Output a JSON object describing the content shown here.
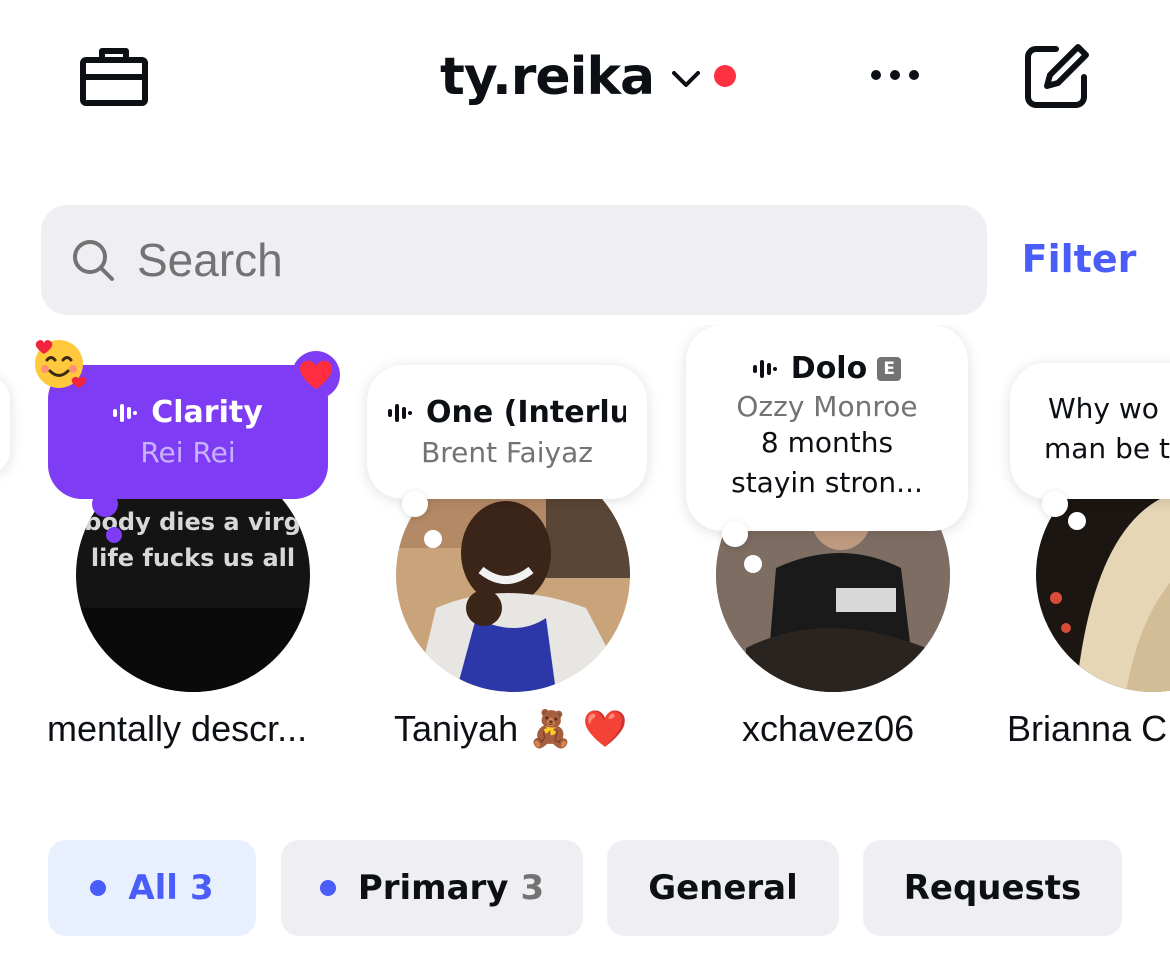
{
  "header": {
    "account_name": "ty.reika",
    "icons": {
      "professional": "briefcase-icon",
      "switch_account": "chevron-down-icon",
      "more": "more-horizontal-icon",
      "new_message": "compose-icon"
    },
    "notification_dot_color": "#ff3040"
  },
  "search": {
    "placeholder": "Search",
    "value": "",
    "filter_label": "Filter"
  },
  "notes": [
    {
      "type": "music",
      "song": "Clarity",
      "artist": "Rei Rei",
      "name": "mentally descr...",
      "own_note": true,
      "bubble_color": "#7e3df5",
      "reactions": [
        "smiling-face-with-hearts-emoji",
        "red-heart-emoji"
      ],
      "avatar_text": [
        "nobody dies a virgin,",
        "life fucks us all"
      ]
    },
    {
      "type": "music",
      "song": "One (Interlu",
      "artist": "Brent Faiyaz",
      "name": "Taniyah 🧸 ❤️"
    },
    {
      "type": "music",
      "song": "Dolo",
      "explicit_badge": "E",
      "artist": "Ozzy Monroe",
      "text_lines": [
        "8 months",
        "stayin stron..."
      ],
      "name": "xchavez06"
    },
    {
      "type": "text",
      "text_lines": [
        "Why wo",
        "man be t"
      ],
      "name": "Brianna C"
    }
  ],
  "tabs": [
    {
      "label": "All",
      "count": "3",
      "active": true,
      "unread_dot": true
    },
    {
      "label": "Primary",
      "count": "3",
      "active": false,
      "unread_dot": true
    },
    {
      "label": "General",
      "count": "",
      "active": false,
      "unread_dot": false
    },
    {
      "label": "Requests",
      "count": "",
      "active": false,
      "unread_dot": false
    }
  ],
  "colors": {
    "accent_blue": "#4a5df9",
    "note_purple": "#7e3df5",
    "tab_bg": "#efeff3",
    "active_tab_bg": "#e8efff",
    "search_bg": "#efeff3"
  }
}
